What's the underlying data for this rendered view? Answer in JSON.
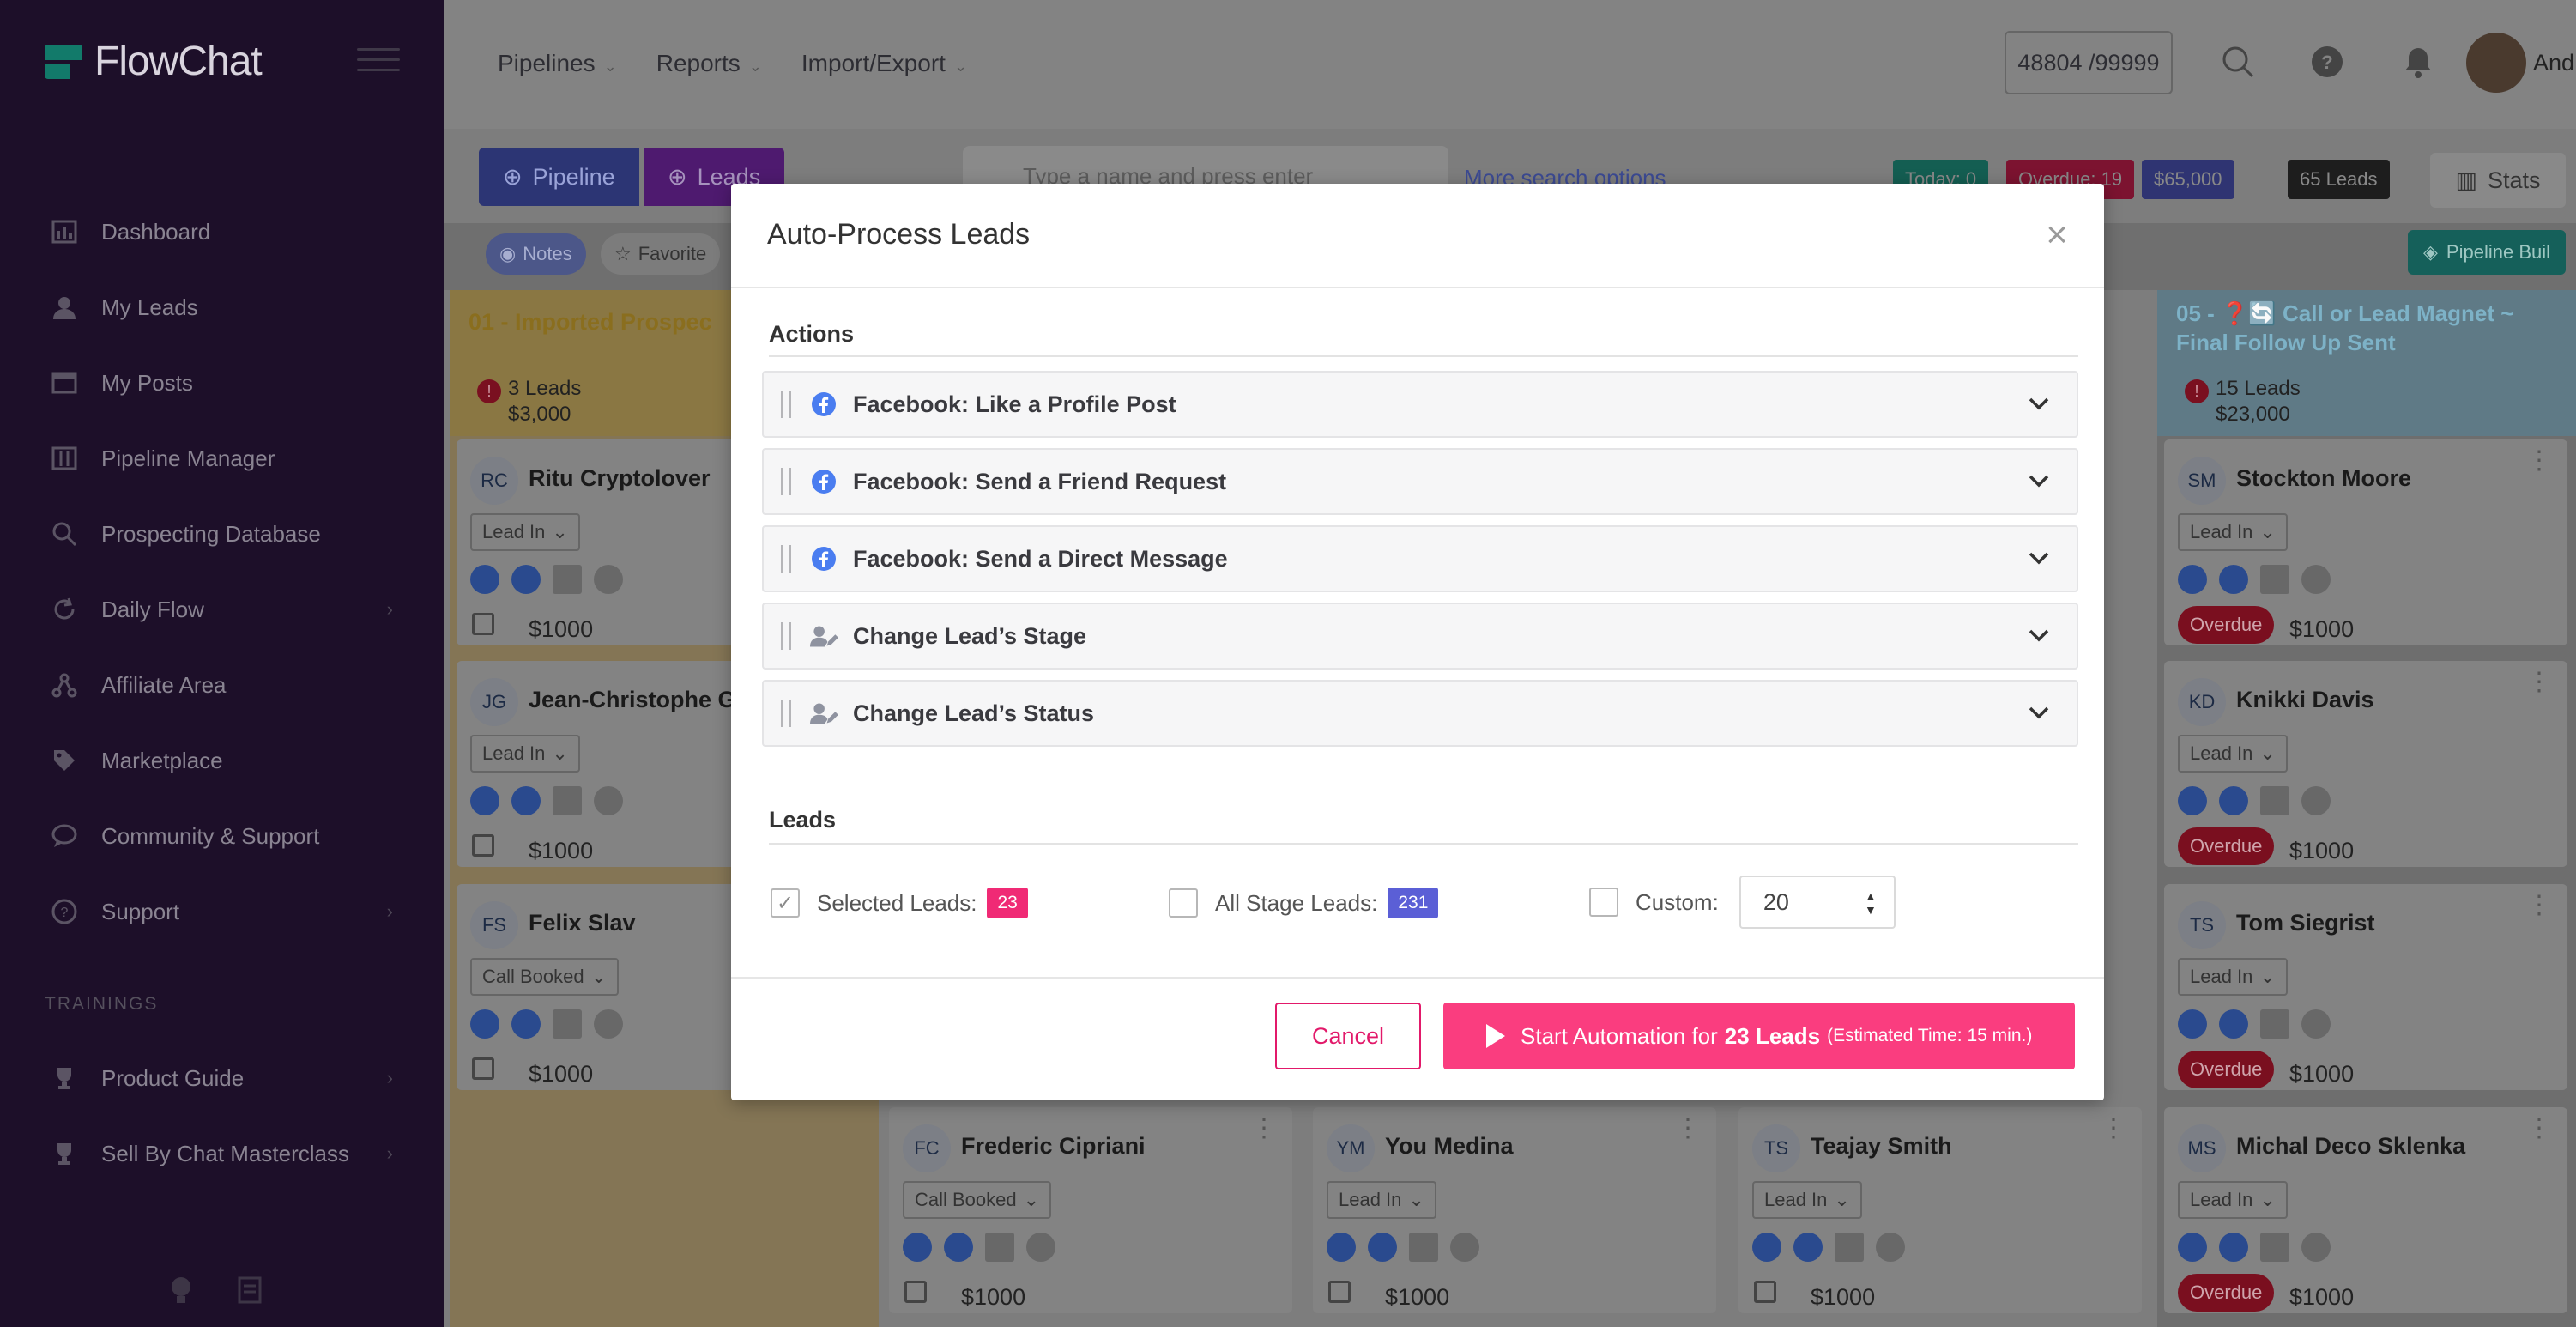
{
  "app": {
    "name": "FlowChat"
  },
  "sidebar": {
    "items": [
      {
        "label": "Dashboard",
        "icon": "dashboard-icon",
        "chevron": false
      },
      {
        "label": "My Leads",
        "icon": "user-icon",
        "chevron": false
      },
      {
        "label": "My Posts",
        "icon": "posts-icon",
        "chevron": false
      },
      {
        "label": "Pipeline Manager",
        "icon": "pipeline-icon",
        "chevron": false
      },
      {
        "label": "Prospecting Database",
        "icon": "search-icon",
        "chevron": false
      },
      {
        "label": "Daily Flow",
        "icon": "refresh-icon",
        "chevron": true
      },
      {
        "label": "Affiliate Area",
        "icon": "affiliate-icon",
        "chevron": false
      },
      {
        "label": "Marketplace",
        "icon": "tag-icon",
        "chevron": false
      },
      {
        "label": "Community & Support",
        "icon": "chat-icon",
        "chevron": false
      },
      {
        "label": "Support",
        "icon": "help-icon",
        "chevron": true
      }
    ],
    "trainings_label": "TRAININGS",
    "trainings": [
      {
        "label": "Product Guide",
        "icon": "trophy-icon"
      },
      {
        "label": "Sell By Chat Masterclass",
        "icon": "trophy-icon"
      }
    ]
  },
  "topbar": {
    "nav": [
      "Pipelines",
      "Reports",
      "Import/Export"
    ],
    "counter": "48804 /99999",
    "user_name": "And"
  },
  "board": {
    "tab_pipeline": "Pipeline",
    "tab_leads": "Leads",
    "search_placeholder": "Type a name and press enter",
    "more_search": "More search options",
    "chip_today": "Today: 0",
    "chip_overdue": "Overdue: 19",
    "chip_value": "$65,000",
    "chip_leads": "65 Leads",
    "stats": "Stats",
    "pill_notes": "Notes",
    "pill_favorite": "Favorite",
    "pipeline_builder": "Pipeline Buil",
    "col1": {
      "title": "01 - Imported Prospec",
      "count": "3 Leads",
      "value": "$3,000"
    },
    "col5": {
      "title_line1": "05 - ❓🔄 Call or Lead Magnet ~",
      "title_line2": "Final Follow Up Sent",
      "count": "15 Leads",
      "value": "$23,000"
    },
    "cards": [
      {
        "initials": "RC",
        "name": "Ritu Cryptolover",
        "status": "Lead In",
        "amount": "$1000"
      },
      {
        "initials": "JG",
        "name": "Jean-Christophe G",
        "status": "Lead In",
        "amount": "$1000"
      },
      {
        "initials": "FS",
        "name": "Felix Slav",
        "status": "Call Booked",
        "amount": "$1000"
      },
      {
        "initials": "SM",
        "name": "Stockton Moore",
        "status": "Lead In",
        "amount": "$1000",
        "overdue": "Overdue"
      },
      {
        "initials": "KD",
        "name": "Knikki Davis",
        "status": "Lead In",
        "amount": "$1000",
        "overdue": "Overdue"
      },
      {
        "initials": "TS",
        "name": "Tom Siegrist",
        "status": "Lead In",
        "amount": "$1000",
        "overdue": "Overdue"
      },
      {
        "initials": "MS",
        "name": "Michal Deco Sklenka",
        "status": "Lead In",
        "amount": "$1000",
        "overdue": "Overdue"
      },
      {
        "initials": "FC",
        "name": "Frederic Cipriani",
        "status": "Call Booked",
        "amount": "$1000"
      },
      {
        "initials": "YM",
        "name": "You Medina",
        "status": "Lead In",
        "amount": "$1000"
      },
      {
        "initials": "TS",
        "name": "Teajay Smith",
        "status": "Lead In",
        "amount": "$1000"
      }
    ]
  },
  "modal": {
    "title": "Auto-Process Leads",
    "actions_heading": "Actions",
    "actions": [
      {
        "label": "Facebook: Like a Profile Post",
        "icon": "facebook-icon"
      },
      {
        "label": "Facebook: Send a Friend Request",
        "icon": "facebook-icon"
      },
      {
        "label": "Facebook: Send a Direct Message",
        "icon": "facebook-icon"
      },
      {
        "label": "Change Lead’s Stage",
        "icon": "user-edit-icon"
      },
      {
        "label": "Change Lead’s Status",
        "icon": "user-edit-icon"
      }
    ],
    "leads_heading": "Leads",
    "selected_label": "Selected Leads:",
    "selected_count": "23",
    "selected_checked": true,
    "all_stage_label": "All Stage Leads:",
    "all_stage_count": "231",
    "custom_label": "Custom:",
    "custom_value": "20",
    "cancel": "Cancel",
    "start_prefix": "Start Automation for",
    "start_count": "23 Leads",
    "start_estimate": "(Estimated Time: 15 min.)"
  },
  "colors": {
    "accent_pink": "#fa3d7f",
    "selected_badge": "#f02a75",
    "all_stage_badge": "#5b5fd6",
    "facebook": "#4a7df0"
  }
}
